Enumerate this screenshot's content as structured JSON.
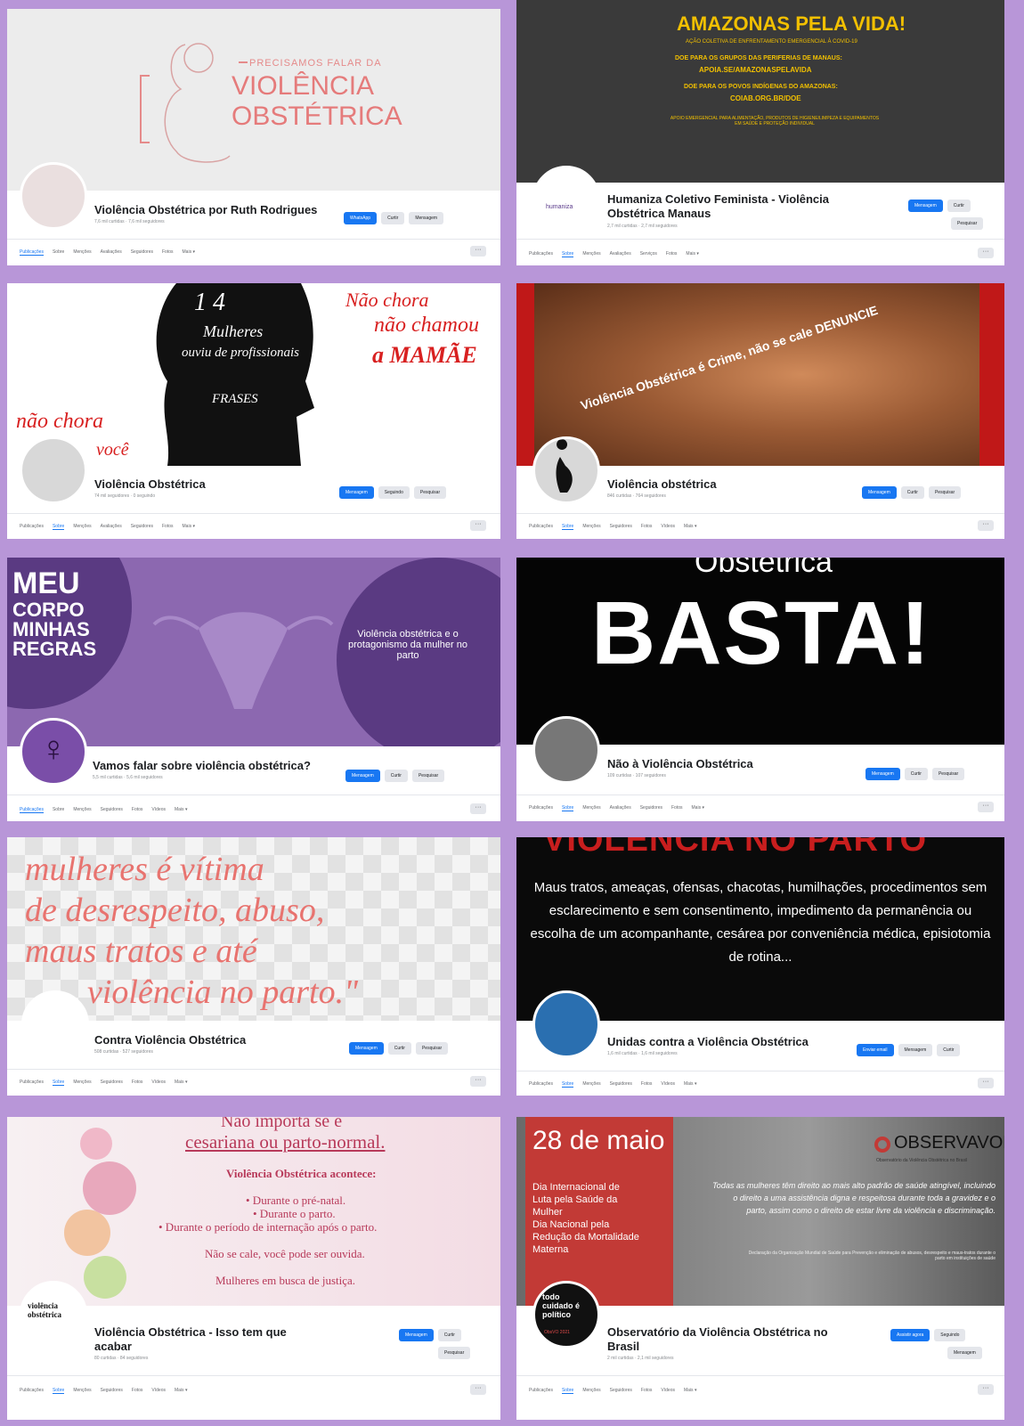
{
  "colors": {
    "facebook_blue": "#1877f2",
    "page_background": "#b896d8"
  },
  "pages": [
    {
      "name": "Violência Obstétrica por Ruth Rodrigues",
      "stats": "7,6 mil curtidas · 7,6 mil seguidores",
      "buttons": [
        "WhatsApp",
        "Curtir",
        "Mensagem"
      ],
      "tabs": [
        "Publicações",
        "Sobre",
        "Menções",
        "Avaliações",
        "Seguidores",
        "Fotos",
        "Mais ▾"
      ],
      "cover": {
        "line1": "PRECISAMOS FALAR DA",
        "line2": "VIOLÊNCIA",
        "line3": "OBSTÉTRICA"
      }
    },
    {
      "name": "Humaniza Coletivo Feminista - Violência Obstétrica Manaus",
      "stats": "2,7 mil curtidas · 2,7 mil seguidores",
      "buttons": [
        "Mensagem",
        "Curtir",
        "Pesquisar"
      ],
      "tabs": [
        "Publicações",
        "Sobre",
        "Menções",
        "Avaliações",
        "Serviços",
        "Fotos",
        "Mais ▾"
      ],
      "avatar_text": "humaniza",
      "cover": {
        "title": "AMAZONAS PELA VIDA!",
        "sub": "AÇÃO COLETIVA DE ENFRENTAMENTO EMERGENCIAL À COVID-19",
        "l1": "DOE PARA OS GRUPOS DAS PERIFERIAS DE MANAUS:",
        "link1": "APOIA.SE/AMAZONASPELAVIDA",
        "l2": "DOE PARA OS POVOS INDÍGENAS DO AMAZONAS:",
        "link2": "COIAB.ORG.BR/DOE",
        "l3": "APOIO EMERGENCIAL PARA ALIMENTAÇÃO, PRODUTOS DE HIGIENE/LIMPEZA E EQUIPAMENTOS EM SAÚDE E PROTEÇÃO INDIVIDUAL"
      }
    },
    {
      "name": "Violência Obstétrica",
      "stats": "74 mil seguidores · 0 seguindo",
      "buttons": [
        "Mensagem",
        "Seguindo",
        "Pesquisar"
      ],
      "tabs": [
        "Publicações",
        "Sobre",
        "Menções",
        "Avaliações",
        "Seguidores",
        "Fotos",
        "Mais ▾"
      ],
      "cover": {
        "c1": "1 4",
        "c2": "Mulheres",
        "c3": "ouviu de profissionais",
        "c4": "FRASES",
        "r1": "Não chora",
        "r2": "não chamou",
        "r3": "a MAMÃE",
        "l1": "não chora",
        "l2": "você"
      }
    },
    {
      "name": "Violência obstétrica",
      "stats": "846 curtidas · 764 seguidores",
      "buttons": [
        "Mensagem",
        "Curtir",
        "Pesquisar"
      ],
      "tabs": [
        "Publicações",
        "Sobre",
        "Menções",
        "Seguidores",
        "Fotos",
        "Vídeos",
        "Mais ▾"
      ],
      "cover": {
        "text": "Violência Obstétrica é Crime, não se cale DENUNCIE"
      }
    },
    {
      "name": "Vamos falar sobre violência obstétrica?",
      "stats": "5,5 mil curtidas · 5,6 mil seguidores",
      "buttons": [
        "Mensagem",
        "Curtir",
        "Pesquisar"
      ],
      "tabs": [
        "Publicações",
        "Sobre",
        "Menções",
        "Seguidores",
        "Fotos",
        "Vídeos",
        "Mais ▾"
      ],
      "cover": {
        "l1": "MEU",
        "l2": "CORPO",
        "l3": "MINHAS",
        "l4": "REGRAS",
        "right": "Violência obstétrica e o protagonismo da mulher no parto"
      }
    },
    {
      "name": "Não à Violência Obstétrica",
      "stats": "109 curtidas · 107 seguidores",
      "buttons": [
        "Mensagem",
        "Curtir",
        "Pesquisar"
      ],
      "tabs": [
        "Publicações",
        "Sobre",
        "Menções",
        "Avaliações",
        "Seguidores",
        "Fotos",
        "Mais ▾"
      ],
      "cover": {
        "top": "Obstétrica",
        "main": "BASTA!"
      }
    },
    {
      "name": "Contra Violência Obstétrica",
      "stats": "508 curtidas · 527 seguidores",
      "buttons": [
        "Mensagem",
        "Curtir",
        "Pesquisar"
      ],
      "tabs": [
        "Publicações",
        "Sobre",
        "Menções",
        "Seguidores",
        "Fotos",
        "Vídeos",
        "Mais ▾"
      ],
      "cover": {
        "l1": "mulheres é vítima",
        "l2": "de desrespeito, abuso,",
        "l3": "maus tratos e até",
        "l4": "violência no parto.\""
      }
    },
    {
      "name": "Unidas contra a Violência Obstétrica",
      "stats": "1,6 mil curtidas · 1,6 mil seguidores",
      "buttons": [
        "Enviar email",
        "Mensagem",
        "Curtir"
      ],
      "tabs": [
        "Publicações",
        "Sobre",
        "Menções",
        "Seguidores",
        "Fotos",
        "Vídeos",
        "Mais ▾"
      ],
      "cover": {
        "title": "VIOLÊNCIA NO PARTO",
        "text": "Maus tratos, ameaças, ofensas, chacotas, humilhações, procedimentos sem esclarecimento e sem consentimento, impedimento da permanência ou escolha de um acompanhante, cesárea por conveniência médica, episiotomia de rotina..."
      }
    },
    {
      "name": "Violência Obstétrica - Isso tem que acabar",
      "stats": "80 curtidas · 84 seguidores",
      "buttons": [
        "Mensagem",
        "Curtir",
        "Pesquisar"
      ],
      "tabs": [
        "Publicações",
        "Sobre",
        "Menções",
        "Seguidores",
        "Fotos",
        "Vídeos",
        "Mais ▾"
      ],
      "avatar_text": "violência obstétrica",
      "cover": {
        "l1": "Não importa se é",
        "l2": "cesariana ou parto-normal.",
        "l3": "Violência Obstétrica acontece:",
        "l4": "• Durante o pré-natal.",
        "l5": "• Durante o parto.",
        "l6": "• Durante o período de internação após o parto.",
        "l7": "Não se cale, você pode ser ouvida.",
        "l8": "Mulheres em busca de justiça."
      }
    },
    {
      "name": "Observatório da Violência Obstétrica no Brasil",
      "stats": "2 mil curtidas · 2,1 mil seguidores",
      "buttons": [
        "Assistir agora",
        "Seguindo",
        "Mensagem"
      ],
      "tabs": [
        "Publicações",
        "Sobre",
        "Menções",
        "Seguidores",
        "Fotos",
        "Vídeos",
        "Mais ▾"
      ],
      "avatar_text": "todo cuidado é político",
      "avatar_year": "ObsVO 2021",
      "cover": {
        "date": "28 de maio",
        "t1": "Dia Internacional de Luta pela Saúde da Mulher",
        "t2": "Dia Nacional pela Redução da Mortalidade Materna",
        "brand": "OBSERVAVOBr",
        "brand_sub": "Observatório da Violência Obstétrica no Brasil",
        "quote": "Todas as mulheres têm direito ao mais alto padrão de saúde atingível, incluindo o direito a uma assistência digna e respeitosa durante toda a gravidez e o parto, assim como o direito de estar livre da violência e discriminação.",
        "cite": "Declaração da Organização Mundial de Saúde para Prevenção e eliminação de abusos, desrespeito e maus-tratos durante o parto em instituições de saúde"
      }
    }
  ]
}
